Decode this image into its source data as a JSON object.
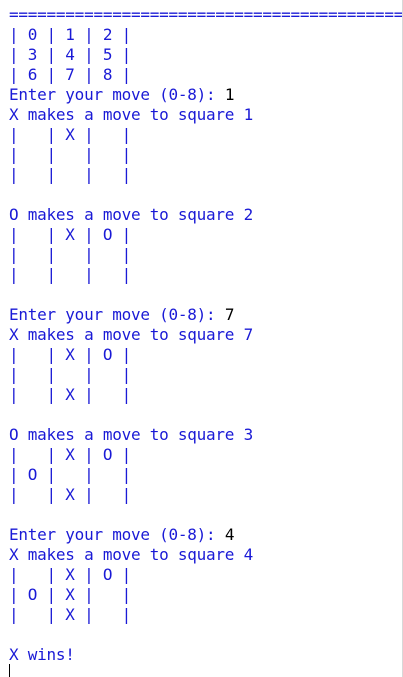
{
  "console": {
    "output_color": "#1a1ad6",
    "input_color": "#000000",
    "lines": [
      {
        "prompt": "==========================================",
        "input": ""
      },
      {
        "prompt": "| 0 | 1 | 2 |",
        "input": ""
      },
      {
        "prompt": "| 3 | 4 | 5 |",
        "input": ""
      },
      {
        "prompt": "| 6 | 7 | 8 |",
        "input": ""
      },
      {
        "prompt": "Enter your move (0-8): ",
        "input": "1"
      },
      {
        "prompt": "X makes a move to square 1",
        "input": ""
      },
      {
        "prompt": "|   | X |   |",
        "input": ""
      },
      {
        "prompt": "|   |   |   |",
        "input": ""
      },
      {
        "prompt": "|   |   |   |",
        "input": ""
      },
      {
        "prompt": "",
        "input": ""
      },
      {
        "prompt": "O makes a move to square 2",
        "input": ""
      },
      {
        "prompt": "|   | X | O |",
        "input": ""
      },
      {
        "prompt": "|   |   |   |",
        "input": ""
      },
      {
        "prompt": "|   |   |   |",
        "input": ""
      },
      {
        "prompt": "",
        "input": ""
      },
      {
        "prompt": "Enter your move (0-8): ",
        "input": "7"
      },
      {
        "prompt": "X makes a move to square 7",
        "input": ""
      },
      {
        "prompt": "|   | X | O |",
        "input": ""
      },
      {
        "prompt": "|   |   |   |",
        "input": ""
      },
      {
        "prompt": "|   | X |   |",
        "input": ""
      },
      {
        "prompt": "",
        "input": ""
      },
      {
        "prompt": "O makes a move to square 3",
        "input": ""
      },
      {
        "prompt": "|   | X | O |",
        "input": ""
      },
      {
        "prompt": "| O |   |   |",
        "input": ""
      },
      {
        "prompt": "|   | X |   |",
        "input": ""
      },
      {
        "prompt": "",
        "input": ""
      },
      {
        "prompt": "Enter your move (0-8): ",
        "input": "4"
      },
      {
        "prompt": "X makes a move to square 4",
        "input": ""
      },
      {
        "prompt": "|   | X | O |",
        "input": ""
      },
      {
        "prompt": "| O | X |   |",
        "input": ""
      },
      {
        "prompt": "|   | X |   |",
        "input": ""
      },
      {
        "prompt": "",
        "input": ""
      },
      {
        "prompt": "X wins!",
        "input": ""
      }
    ]
  }
}
